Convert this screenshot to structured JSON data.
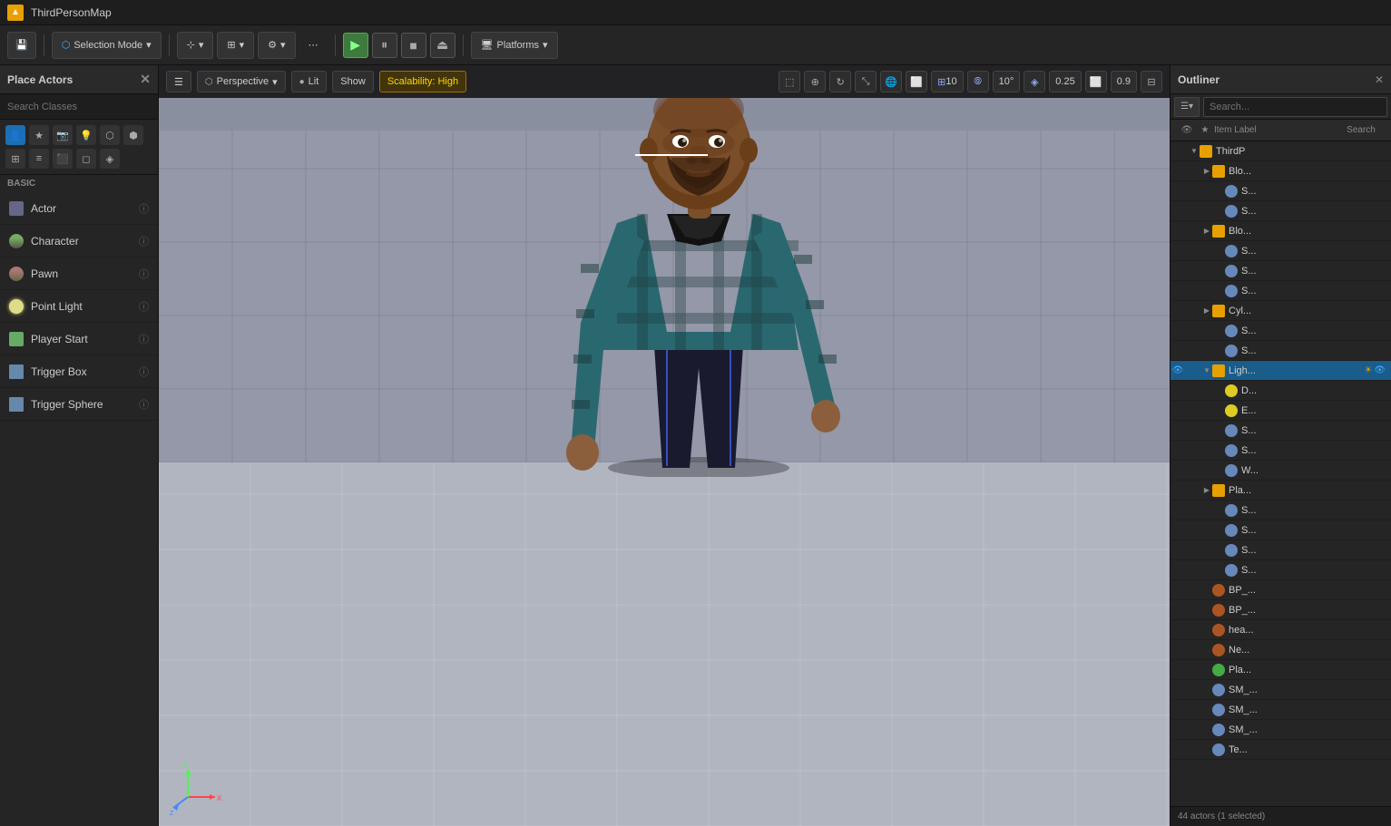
{
  "titlebar": {
    "app_name": "ThirdPersonMap",
    "icon_label": "UE"
  },
  "toolbar": {
    "selection_mode_label": "Selection Mode",
    "transform_label": "Transform",
    "snap_label": "Snap",
    "build_label": "Build",
    "platforms_label": "Platforms",
    "play_tooltip": "Play",
    "pause_tooltip": "Pause",
    "stop_tooltip": "Stop",
    "eject_tooltip": "Eject"
  },
  "left_panel": {
    "title": "Place Actors",
    "search_placeholder": "Search Classes",
    "basic_label": "BASIC",
    "actors": [
      {
        "id": "actor",
        "name": "Actor",
        "icon": "cube"
      },
      {
        "id": "character",
        "name": "Character",
        "icon": "person"
      },
      {
        "id": "pawn",
        "name": "Pawn",
        "icon": "pawn-ic"
      },
      {
        "id": "point-light",
        "name": "Point Light",
        "icon": "light-ic"
      },
      {
        "id": "player-start",
        "name": "Player Start",
        "icon": "flag-ic"
      },
      {
        "id": "trigger-box",
        "name": "Trigger Box",
        "icon": "trigger-ic"
      },
      {
        "id": "trigger-sphere",
        "name": "Trigger Sphere",
        "icon": "trigger-ic"
      }
    ],
    "category_icons": [
      "person",
      "star",
      "camera",
      "light",
      "effects",
      "geo",
      "volumes",
      "all"
    ]
  },
  "viewport": {
    "perspective_label": "Perspective",
    "lit_label": "Lit",
    "show_label": "Show",
    "scalability_label": "Scalability: High",
    "grid_num": "10",
    "angle_num": "10°",
    "scale_num": "0.25",
    "ratio_num": "0.9"
  },
  "outliner": {
    "title": "Outliner",
    "search_placeholder": "Search...",
    "column_eye": "👁",
    "column_star": "★",
    "column_label": "Item Label",
    "column_search": "Search",
    "status": "44 actors (1 selected)",
    "items": [
      {
        "id": "thirdperson",
        "label": "ThirdP",
        "indent": 0,
        "type": "folder",
        "arrow": "▼"
      },
      {
        "id": "blo1",
        "label": "Blo...",
        "indent": 1,
        "type": "folder",
        "arrow": "▶"
      },
      {
        "id": "s1",
        "label": "S...",
        "indent": 2,
        "type": "mesh",
        "arrow": ""
      },
      {
        "id": "s2",
        "label": "S...",
        "indent": 2,
        "type": "mesh",
        "arrow": ""
      },
      {
        "id": "blo2",
        "label": "Blo...",
        "indent": 1,
        "type": "folder",
        "arrow": "▶"
      },
      {
        "id": "s3",
        "label": "S...",
        "indent": 2,
        "type": "mesh",
        "arrow": ""
      },
      {
        "id": "s4",
        "label": "S...",
        "indent": 2,
        "type": "mesh",
        "arrow": ""
      },
      {
        "id": "s5",
        "label": "S...",
        "indent": 2,
        "type": "mesh",
        "arrow": ""
      },
      {
        "id": "cyl",
        "label": "Cyl...",
        "indent": 1,
        "type": "folder",
        "arrow": "▶"
      },
      {
        "id": "s6",
        "label": "S...",
        "indent": 2,
        "type": "mesh",
        "arrow": ""
      },
      {
        "id": "s7",
        "label": "S...",
        "indent": 2,
        "type": "mesh",
        "arrow": ""
      },
      {
        "id": "ligh",
        "label": "Ligh...",
        "indent": 1,
        "type": "folder",
        "arrow": "▼",
        "selected": true
      },
      {
        "id": "d1",
        "label": "D...",
        "indent": 2,
        "type": "light",
        "arrow": ""
      },
      {
        "id": "e1",
        "label": "E...",
        "indent": 2,
        "type": "light",
        "arrow": ""
      },
      {
        "id": "s8",
        "label": "S...",
        "indent": 2,
        "type": "mesh",
        "arrow": ""
      },
      {
        "id": "s9",
        "label": "S...",
        "indent": 2,
        "type": "mesh",
        "arrow": ""
      },
      {
        "id": "w1",
        "label": "W...",
        "indent": 2,
        "type": "mesh",
        "arrow": ""
      },
      {
        "id": "play",
        "label": "Pla...",
        "indent": 1,
        "type": "folder",
        "arrow": "▶"
      },
      {
        "id": "s10",
        "label": "S...",
        "indent": 2,
        "type": "mesh",
        "arrow": ""
      },
      {
        "id": "s11",
        "label": "S...",
        "indent": 2,
        "type": "mesh",
        "arrow": ""
      },
      {
        "id": "s12",
        "label": "S...",
        "indent": 2,
        "type": "mesh",
        "arrow": ""
      },
      {
        "id": "s13",
        "label": "S...",
        "indent": 2,
        "type": "mesh",
        "arrow": ""
      },
      {
        "id": "bp",
        "label": "BP_...",
        "indent": 1,
        "type": "actor",
        "arrow": ""
      },
      {
        "id": "bpx",
        "label": "BP_...",
        "indent": 1,
        "type": "actor",
        "arrow": ""
      },
      {
        "id": "hea",
        "label": "hea...",
        "indent": 1,
        "type": "actor",
        "arrow": ""
      },
      {
        "id": "nev",
        "label": "Ne...",
        "indent": 1,
        "type": "actor",
        "arrow": ""
      },
      {
        "id": "pla",
        "label": "Pla...",
        "indent": 1,
        "type": "player",
        "arrow": ""
      },
      {
        "id": "sm1",
        "label": "SM_...",
        "indent": 1,
        "type": "mesh",
        "arrow": ""
      },
      {
        "id": "sm2",
        "label": "SM_...",
        "indent": 1,
        "type": "mesh",
        "arrow": ""
      },
      {
        "id": "sm3",
        "label": "SM_...",
        "indent": 1,
        "type": "mesh",
        "arrow": ""
      },
      {
        "id": "tex",
        "label": "Te...",
        "indent": 1,
        "type": "mesh",
        "arrow": ""
      }
    ]
  }
}
